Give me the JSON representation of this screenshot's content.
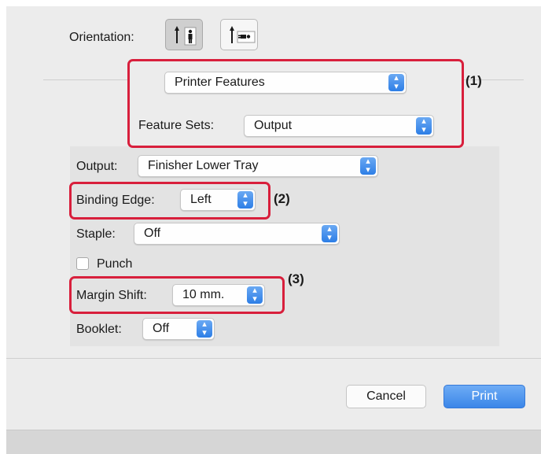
{
  "orientation": {
    "label": "Orientation:",
    "options": [
      {
        "icon": "portrait-orientation-icon",
        "selected": true
      },
      {
        "icon": "landscape-orientation-icon",
        "selected": false
      }
    ]
  },
  "section_popup": {
    "value": "Printer Features"
  },
  "feature_sets": {
    "label": "Feature Sets:",
    "value": "Output"
  },
  "output": {
    "label": "Output:",
    "value": "Finisher Lower Tray"
  },
  "binding_edge": {
    "label": "Binding Edge:",
    "value": "Left"
  },
  "staple": {
    "label": "Staple:",
    "value": "Off"
  },
  "punch": {
    "label": "Punch",
    "checked": false
  },
  "margin_shift": {
    "label": "Margin Shift:",
    "value": "10 mm."
  },
  "booklet": {
    "label": "Booklet:",
    "value": "Off"
  },
  "callouts": {
    "one": "(1)",
    "two": "(2)",
    "three": "(3)"
  },
  "buttons": {
    "cancel": "Cancel",
    "print": "Print"
  },
  "colors": {
    "highlight_box": "#d81f3c",
    "accent": "#3b86e8"
  }
}
